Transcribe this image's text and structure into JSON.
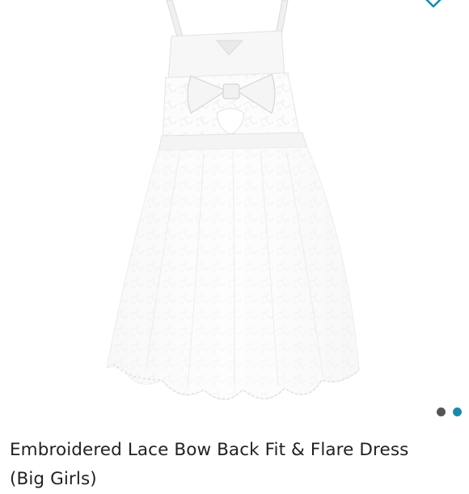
{
  "product": {
    "image_alt": "White lace dress with bow back",
    "title": "Embroidered Lace Bow Back Fit & Flare Dress",
    "title_line2": "(Big Girls)"
  },
  "favorite": {
    "icon": "heart-icon",
    "color": "#1a8ca6"
  },
  "carousel": {
    "dots": [
      {
        "state": "inactive",
        "color": "#555555"
      },
      {
        "state": "active",
        "color": "#1a8ca6"
      }
    ]
  }
}
